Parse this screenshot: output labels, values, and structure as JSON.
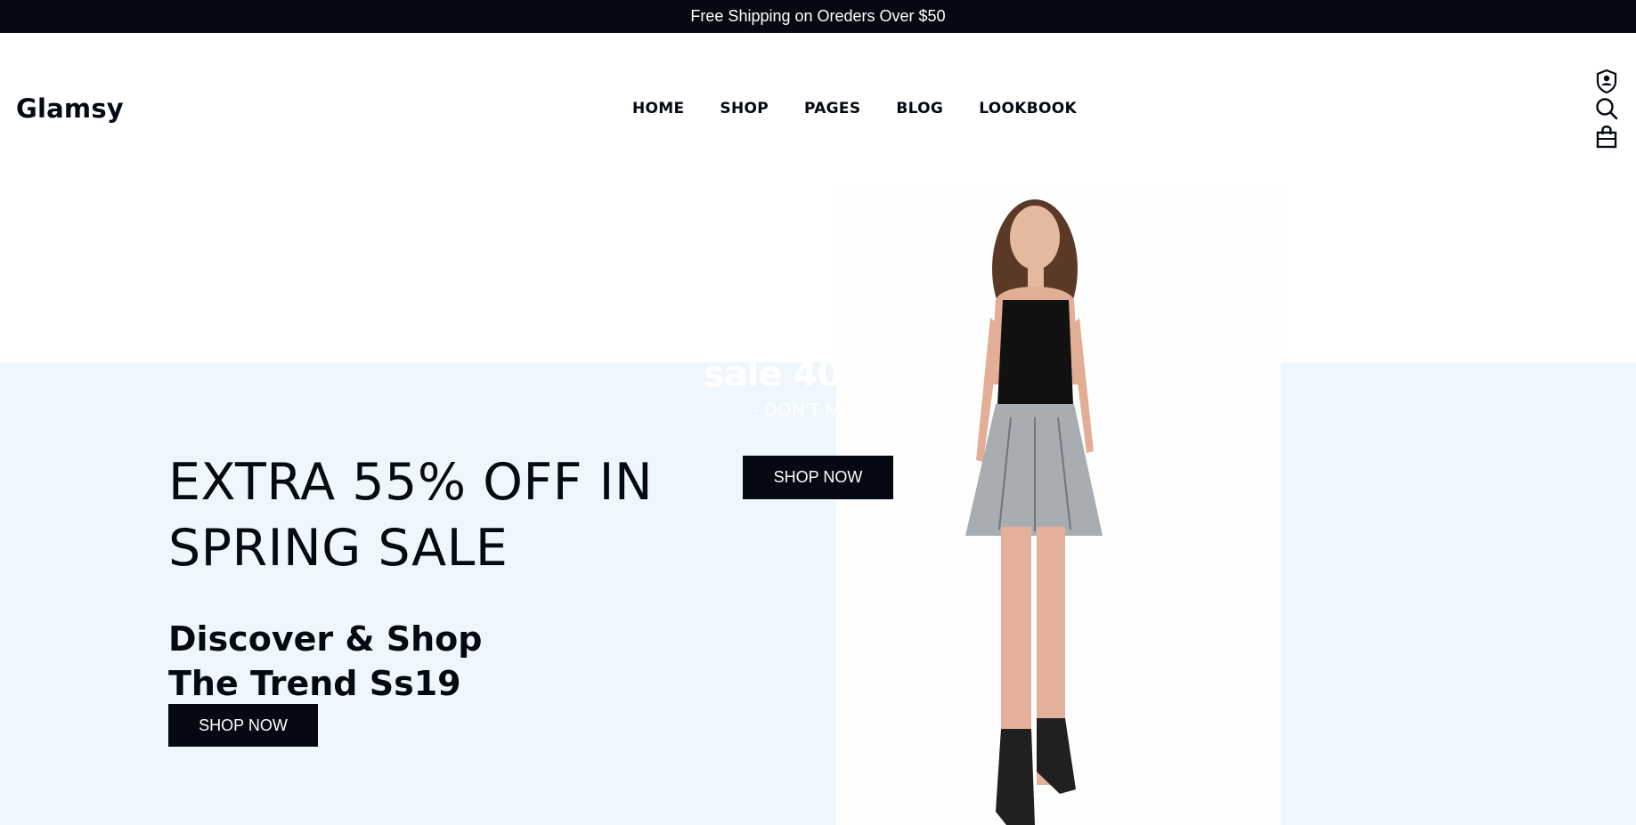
{
  "announcement": {
    "text": "Free Shipping on Oreders Over $50"
  },
  "header": {
    "logo": "Glamsy",
    "nav": [
      "HOME",
      "SHOP",
      "PAGES",
      "BLOG",
      "LOOKBOOK"
    ],
    "icons": [
      "account-shield-icon",
      "search-icon",
      "shopping-bag-icon"
    ]
  },
  "hero": {
    "ghost_title": "sale 40%off",
    "ghost_subtitle": "- DON'T MISS -",
    "top_button": "SHOP NOW",
    "headline_line1": "EXTRA 55% OFF IN",
    "headline_line2": "SPRING SALE",
    "sub_line1": "Discover & Shop",
    "sub_line2": "The Trend Ss19",
    "main_button": "SHOP NOW"
  },
  "colors": {
    "dark": "#050914",
    "hero_bg": "#eff7fc",
    "white": "#ffffff"
  }
}
